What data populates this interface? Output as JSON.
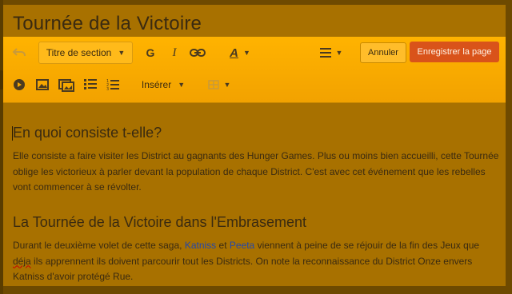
{
  "page": {
    "title": "Tournée de la Victoire"
  },
  "toolbar": {
    "section_dropdown": "Titre de section",
    "bold_label": "G",
    "italic_label": "I",
    "textstyle_label": "A",
    "insert_label": "Insérer",
    "cancel_label": "Annuler",
    "save_label": "Enregistrer la page",
    "icons": [
      "undo-icon",
      "link-icon",
      "align-icon",
      "media-icon",
      "image-icon",
      "gallery-icon",
      "bullet-list-icon",
      "numbered-list-icon",
      "table-icon"
    ]
  },
  "content": {
    "section1": {
      "heading": "En quoi consiste t-elle?",
      "text": "Elle consiste a faire visiter les District au gagnants des Hunger Games. Plus ou moins bien accueilli, cette Tournée oblige les victorieux à parler devant la population de chaque District. C'est avec cet événement que les rebelles vont commencer à se révolter."
    },
    "section2": {
      "heading": "La Tournée de la Victoire dans l'Embrasement",
      "text_before": "Durant le deuxième volet de cette saga,",
      "link1": "Katniss",
      "text_mid": "et",
      "link2": "Peeta",
      "text_after1": "viennent à peine de se réjouir de la fin des Jeux que",
      "misspelled": "déja",
      "text_after2": "ils apprennent ils doivent parcourir tout les Districts. On note la reconnaissance du District Onze envers Katniss d'avoir protégé Rue."
    }
  },
  "colors": {
    "toolbar": "#ffb300",
    "save_button": "#d9531a",
    "link": "#2447a8",
    "background": "#a87100"
  }
}
